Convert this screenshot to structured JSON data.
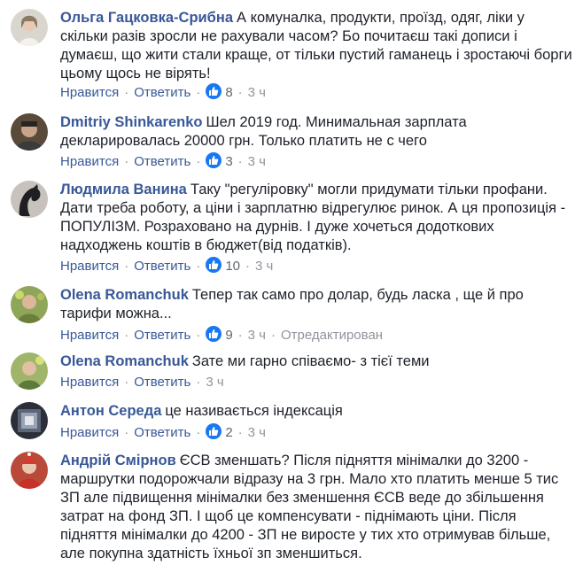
{
  "comments": [
    {
      "author": "Ольга Гацковка-Срибна",
      "text": "А комуналка, продукти, проїзд, одяг, ліки у скільки разів зросли не рахували часом? Бо почитаєш такі дописи і думаєш, що жити стали краще, от тільки пустий гаманець і зростаючі борги цьому щось не вірять!",
      "like_label": "Нравится",
      "reply_label": "Ответить",
      "reactions": "8",
      "time": "3 ч",
      "edited": ""
    },
    {
      "author": "Dmitriy Shinkarenko",
      "text": "Шел 2019 год. Минимальная зарплата декларировалась 20000 грн. Только платить не с чего",
      "like_label": "Нравится",
      "reply_label": "Ответить",
      "reactions": "3",
      "time": "3 ч",
      "edited": ""
    },
    {
      "author": "Людмила Ванина",
      "text": "Таку \"регуліровку\" могли придумати тільки профани. Дати треба роботу, а ціни і зарплатню відрегулює ринок. А ця пропозиція - ПОПУЛІЗМ. Розраховано на дурнів. І дуже хочеться додоткових надходжень коштів в бюджет(від податків).",
      "like_label": "Нравится",
      "reply_label": "Ответить",
      "reactions": "10",
      "time": "3 ч",
      "edited": ""
    },
    {
      "author": "Olena Romanchuk",
      "text": "Тепер так само про долар, будь ласка , ще й про тарифи можна...",
      "like_label": "Нравится",
      "reply_label": "Ответить",
      "reactions": "9",
      "time": "3 ч",
      "edited": "Отредактирован"
    },
    {
      "author": "Olena Romanchuk",
      "text": "Зате ми гарно співаємо- з тієї теми",
      "like_label": "Нравится",
      "reply_label": "Ответить",
      "reactions": "",
      "time": "3 ч",
      "edited": ""
    },
    {
      "author": "Антон Середа",
      "text": "це називається індексація",
      "like_label": "Нравится",
      "reply_label": "Ответить",
      "reactions": "2",
      "time": "3 ч",
      "edited": ""
    },
    {
      "author": "Андрій Смірнов",
      "text": "ЄСВ зменшать? Після підняття мінімалки до 3200 - маршрутки подорожчали відразу на 3 грн. Мало хто платить менше 5 тис ЗП але підвищення мінімалки без зменшення ЄСВ веде до збільшення затрат на фонд ЗП. І щоб це компенсувати - піднімають ціни. Після підняття мінімалки до 4200 - ЗП не виросте у тих хто отримував більше, але покупна здатність їхньої зп зменшиться.",
      "like_label": "",
      "reply_label": "",
      "reactions": "",
      "time": "",
      "edited": ""
    }
  ],
  "colors": {
    "author": "#385898",
    "text": "#1d2129",
    "meta": "#90949c",
    "like_badge": "#1877f2"
  },
  "icons": {
    "reaction": "thumbs-up-icon"
  }
}
